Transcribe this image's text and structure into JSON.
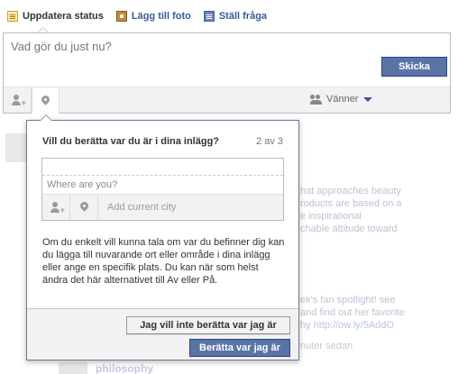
{
  "composer": {
    "tabs": [
      {
        "label": "Uppdatera status",
        "icon": "status-icon"
      },
      {
        "label": "Lägg till foto",
        "icon": "photo-icon"
      },
      {
        "label": "Ställ fråga",
        "icon": "question-icon"
      }
    ],
    "placeholder": "Vad gör du just nu?",
    "audience_label": "Vänner",
    "share_label": "Skicka"
  },
  "dialog": {
    "title": "Vill du berätta var du är i dina inlägg?",
    "step": "2 av 3",
    "location_placeholder": "Where are you?",
    "city_placeholder": "Add current city",
    "description": "Om du enkelt vill kunna tala om var du befinner dig kan du lägga till nuvarande ort eller område i dina inlägg eller ange en specifik plats. Du kan när som helst ändra det här alternativet till Av eller På.",
    "decline_label": "Jag vill inte berätta var jag är",
    "accept_label": "Berätta var jag är"
  },
  "feed_fragments": {
    "line1": "hat approaches beauty",
    "line2": "roducts are based on a",
    "line3": "e inspirational",
    "line4": "chable attitude toward",
    "line5": "ek's fan spotlight! see",
    "line6": "and find out her favorite",
    "line7_prefix": "hy ",
    "line7_link": "http://ow.ly/5AddO",
    "line8": "nuter sedan",
    "line9": "philosophy"
  },
  "colors": {
    "brand_blue": "#3b5998",
    "button_blue": "#5b74a8",
    "border": "#b4bbcd"
  }
}
